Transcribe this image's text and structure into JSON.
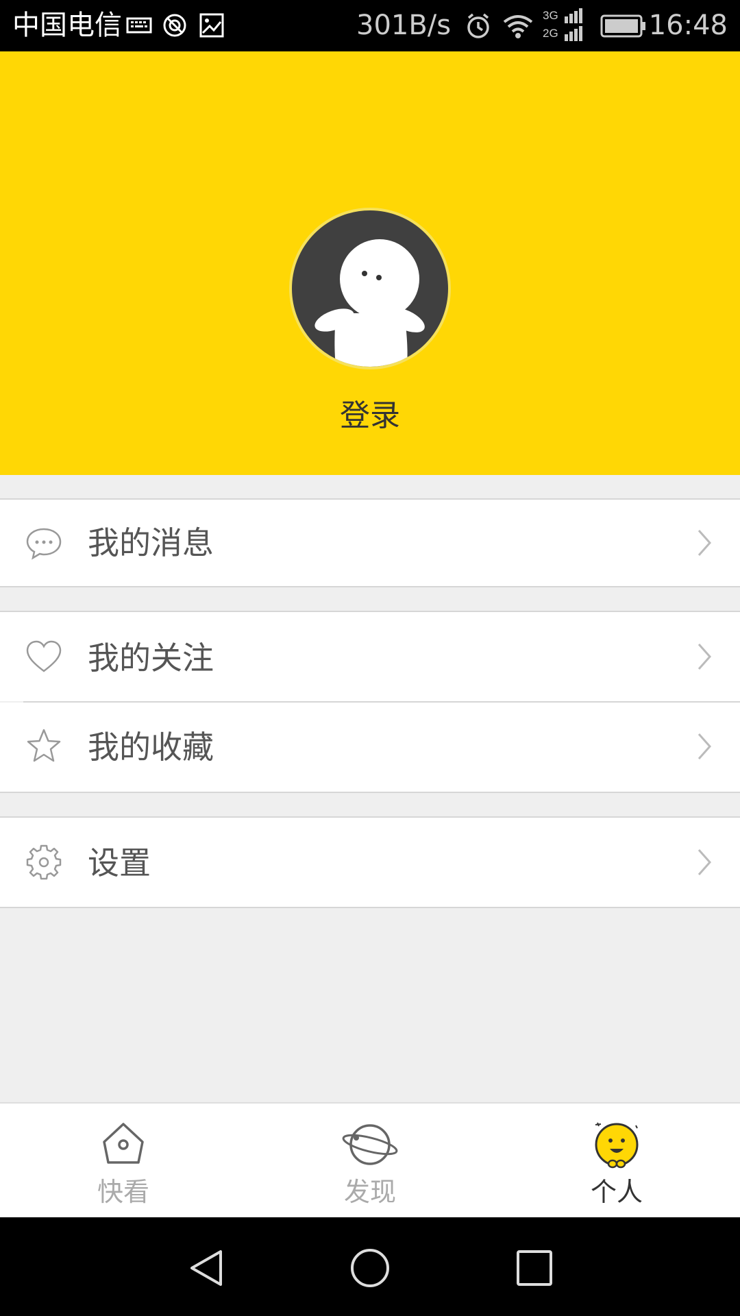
{
  "status_bar": {
    "carrier": "中国电信",
    "speed": "301B/s",
    "network_top": "3G",
    "network_bottom": "2G",
    "time": "16:48",
    "icons": [
      "keyboard-icon",
      "sync-icon",
      "image-icon",
      "alarm-icon",
      "wifi-icon",
      "signal-icon",
      "battery-icon"
    ]
  },
  "profile": {
    "login_label": "登录",
    "background_color": "#ffd705"
  },
  "menu": {
    "messages": {
      "label": "我的消息",
      "icon": "chat-bubble-icon"
    },
    "following": {
      "label": "我的关注",
      "icon": "heart-icon"
    },
    "favorites": {
      "label": "我的收藏",
      "icon": "star-icon"
    },
    "settings": {
      "label": "设置",
      "icon": "gear-icon"
    }
  },
  "bottom_nav": {
    "tabs": [
      {
        "label": "快看",
        "icon": "home-icon",
        "active": false
      },
      {
        "label": "发现",
        "icon": "planet-icon",
        "active": false
      },
      {
        "label": "个人",
        "icon": "smiley-icon",
        "active": true
      }
    ]
  }
}
